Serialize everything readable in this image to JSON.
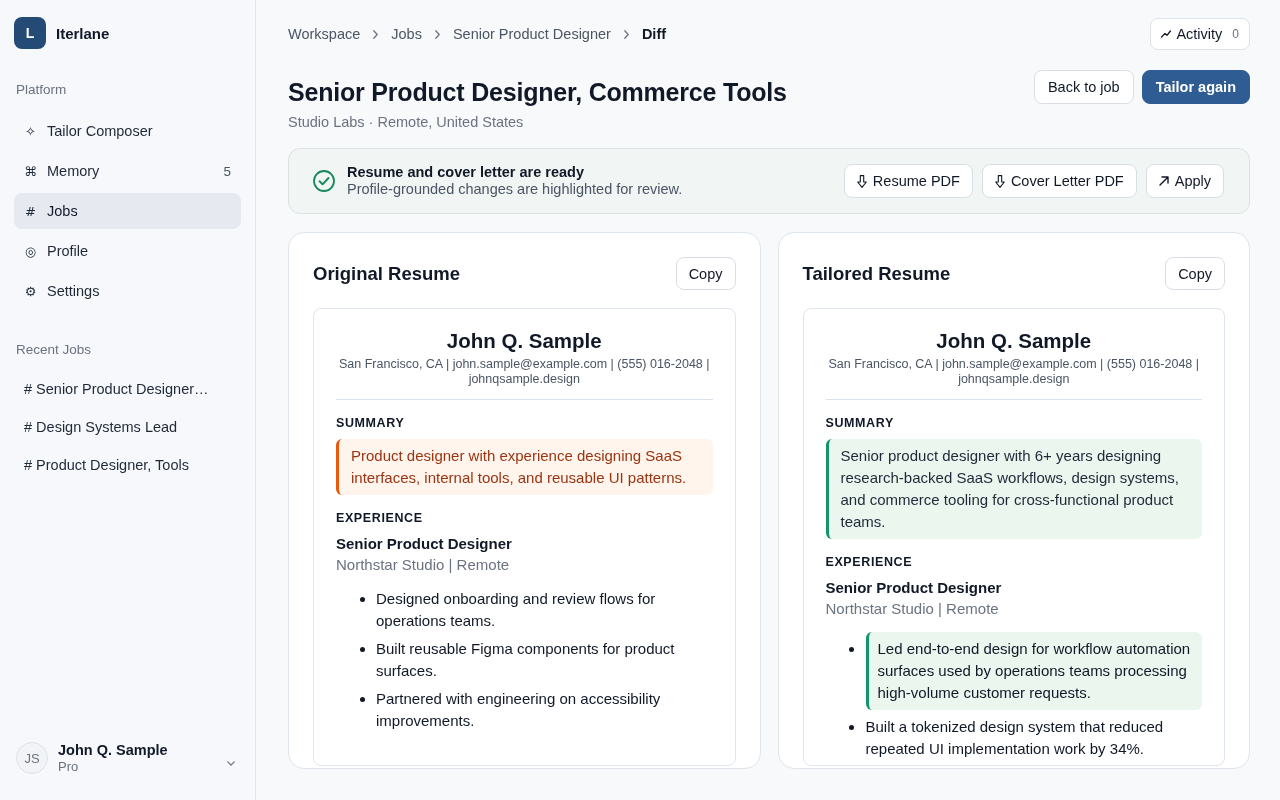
{
  "sidebar": {
    "brand": {
      "logo_letter": "L",
      "name": "Iterlane"
    },
    "platform_label": "Platform",
    "nav": [
      {
        "icon": "✧",
        "label": "Tailor Composer",
        "selected": false
      },
      {
        "icon": "⌘",
        "label": "Memory",
        "count": "5",
        "selected": false
      },
      {
        "icon": "#",
        "label": "Jobs",
        "selected": true
      },
      {
        "icon": "◎",
        "label": "Profile",
        "selected": false
      },
      {
        "icon": "⚙",
        "label": "Settings",
        "selected": false
      }
    ],
    "recent_label": "Recent Jobs",
    "recent_jobs": [
      {
        "label": "# Senior Product Designer…"
      },
      {
        "label": "# Design Systems Lead"
      },
      {
        "label": "# Product Designer, Tools"
      }
    ],
    "user": {
      "initials": "JS",
      "name": "John Q. Sample",
      "plan": "Pro"
    }
  },
  "breadcrumb": [
    {
      "label": "Workspace",
      "current": false
    },
    {
      "label": "Jobs",
      "current": false
    },
    {
      "label": "Senior Product Designer",
      "current": false
    },
    {
      "label": "Diff",
      "current": true
    }
  ],
  "activity": {
    "label": "Activity",
    "count": "0"
  },
  "job": {
    "title": "Senior Product Designer, Commerce Tools",
    "subtitle": "Studio Labs · Remote, United States"
  },
  "actions": [
    {
      "label": "Back to job",
      "kind": "secondary"
    },
    {
      "label": "Tailor again",
      "kind": "primary"
    }
  ],
  "banner": {
    "title": "Resume and cover letter are ready",
    "message": "Profile-grounded changes are highlighted for review.",
    "actions": [
      {
        "label": "Resume PDF",
        "kind": "download"
      },
      {
        "label": "Cover Letter PDF",
        "kind": "download"
      },
      {
        "label": "Apply",
        "kind": "external"
      }
    ]
  },
  "resumes": [
    {
      "title": "Original Resume",
      "copy_label": "Copy",
      "name": "John Q. Sample",
      "contact": "San Francisco, CA | john.sample@example.com | (555) 016-2048 | johnqsample.design",
      "summary": {
        "heading": "SUMMARY",
        "text": "Product designer with experience designing SaaS interfaces, internal tools, and reusable UI patterns.",
        "kind": "removed"
      },
      "experience": {
        "heading": "EXPERIENCE",
        "jobs": [
          {
            "title": "Senior Product Designer",
            "meta": "Northstar Studio | Remote",
            "bullets": [
              {
                "text": "Designed onboarding and review flows for operations teams.",
                "kind": "plain"
              },
              {
                "text": "Built reusable Figma components for product surfaces.",
                "kind": "plain"
              },
              {
                "text": "Partnered with engineering on accessibility improvements.",
                "kind": "plain"
              }
            ]
          }
        ]
      }
    },
    {
      "title": "Tailored Resume",
      "copy_label": "Copy",
      "name": "John Q. Sample",
      "contact": "San Francisco, CA | john.sample@example.com | (555) 016-2048 | johnqsample.design",
      "summary": {
        "heading": "SUMMARY",
        "text": "Senior product designer with 6+ years designing research-backed SaaS workflows, design systems, and commerce tooling for cross-functional product teams.",
        "kind": "added"
      },
      "experience": {
        "heading": "EXPERIENCE",
        "jobs": [
          {
            "title": "Senior Product Designer",
            "meta": "Northstar Studio | Remote",
            "bullets": [
              {
                "text": "Led end-to-end design for workflow automation surfaces used by operations teams processing high-volume customer requests.",
                "kind": "added"
              },
              {
                "text": "Built a tokenized design system that reduced repeated UI implementation work by 34%.",
                "kind": "plain"
              }
            ]
          }
        ]
      }
    }
  ]
}
